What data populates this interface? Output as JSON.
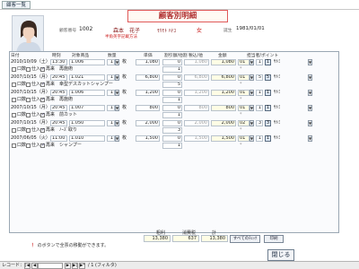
{
  "window": {
    "tab_label": "顧客一覧"
  },
  "page_title": "顧客別明細",
  "customer": {
    "id_label": "顧客番号",
    "id_value": "1002",
    "name": "森本　花子",
    "kana": "ﾓﾘﾓﾄ ﾊﾅｺ",
    "gender": "女",
    "birth_label": "誕生",
    "birth_value": "1981/01/01",
    "note": "半角英字記載方法"
  },
  "columns": {
    "date": "日付",
    "time": "時刻",
    "item": "対象商品",
    "qty": "数量",
    "price": "単価",
    "disc": "割引額/他割",
    "tax": "税込/他",
    "amount": "金額",
    "staff": "担当者/ポイント"
  },
  "records": [
    {
      "date": "2010/10/09（土）",
      "time": "13:30",
      "code": "1.006",
      "qty": "1",
      "unit": "枚",
      "price": "1,080",
      "disc": "0",
      "tax": "1,080",
      "amount": "1,080",
      "staff_no": "01",
      "pts": "1",
      "staff_name": "ｻﾄﾐ",
      "kokyaku": "再来",
      "item_name": "再施術",
      "sub": "1"
    },
    {
      "date": "2007/10/15（月）",
      "time": "20:45",
      "code": "1.021",
      "qty": "1",
      "unit": "枚",
      "price": "6,800",
      "disc": "0",
      "tax": "6,800",
      "amount": "6,800",
      "staff_no": "01",
      "pts": "5",
      "staff_name": "ｻﾄﾐ",
      "kokyaku": "再来",
      "item_name": "幸型デスカットシャンプー",
      "sub": "5"
    },
    {
      "date": "2007/10/15（月）",
      "time": "20:45",
      "code": "1.006",
      "qty": "1",
      "unit": "枚",
      "price": "1,200",
      "disc": "0",
      "tax": "1,200",
      "amount": "1,200",
      "staff_no": "01",
      "pts": "1",
      "staff_name": "ｻﾄﾐ",
      "kokyaku": "再来",
      "item_name": "再施術",
      "sub": "1"
    },
    {
      "date": "2007/10/15（月）",
      "time": "20:45",
      "code": "1.007",
      "qty": "1",
      "unit": "枚",
      "price": "800",
      "disc": "0",
      "tax": "800",
      "amount": "800",
      "staff_no": "01",
      "pts": "1",
      "staff_name": "ｻﾄﾐ",
      "kokyaku": "再来",
      "item_name": "前カット",
      "sub": "1"
    },
    {
      "date": "2007/10/15（月）",
      "time": "20:45",
      "code": "1.050",
      "qty": "1",
      "unit": "枚",
      "price": "2,000",
      "disc": "0",
      "tax": "2,000",
      "amount": "2,000",
      "staff_no": "02",
      "pts": "3",
      "staff_name": "ｻﾄﾐ",
      "kokyaku": "再来",
      "item_name": "ﾉｰｽﾞ取り",
      "sub": "3"
    },
    {
      "date": "2007/06/05（火）",
      "time": "11:00",
      "code": "1.010",
      "qty": "1",
      "unit": "枚",
      "price": "1,500",
      "disc": "0",
      "tax": "1,500",
      "amount": "1,500",
      "staff_no": "01",
      "pts": "1",
      "staff_name": "ｻﾄﾐ",
      "kokyaku": "再来",
      "item_name": "シャンプー",
      "sub": "1"
    }
  ],
  "row_labels": {
    "opt1": "口数",
    "opt2": "仕入",
    "opt3": "再来"
  },
  "totals": {
    "sales_label": "粗利",
    "sales_value": "13,380",
    "cost_label": "消費税",
    "cost_value": "637",
    "total_label": "計",
    "total_value": "13,380"
  },
  "buttons": {
    "select_all": "すべてのﾁｪｯｸ",
    "print": "印刷",
    "close": "閉じる"
  },
  "note": {
    "mark": "！",
    "text": "のボタンで全票の移動ができます。"
  },
  "statusbar": {
    "record_label": "レコード：",
    "nav_first": "|◀",
    "nav_prev": "◀",
    "nav_next": "▶",
    "nav_last": "▶|",
    "nav_new": "▶*",
    "record_of": "/ 1 (フィルタ)"
  },
  "colors": {
    "title_border": "#e05a5a",
    "accent": "#cc2222"
  }
}
